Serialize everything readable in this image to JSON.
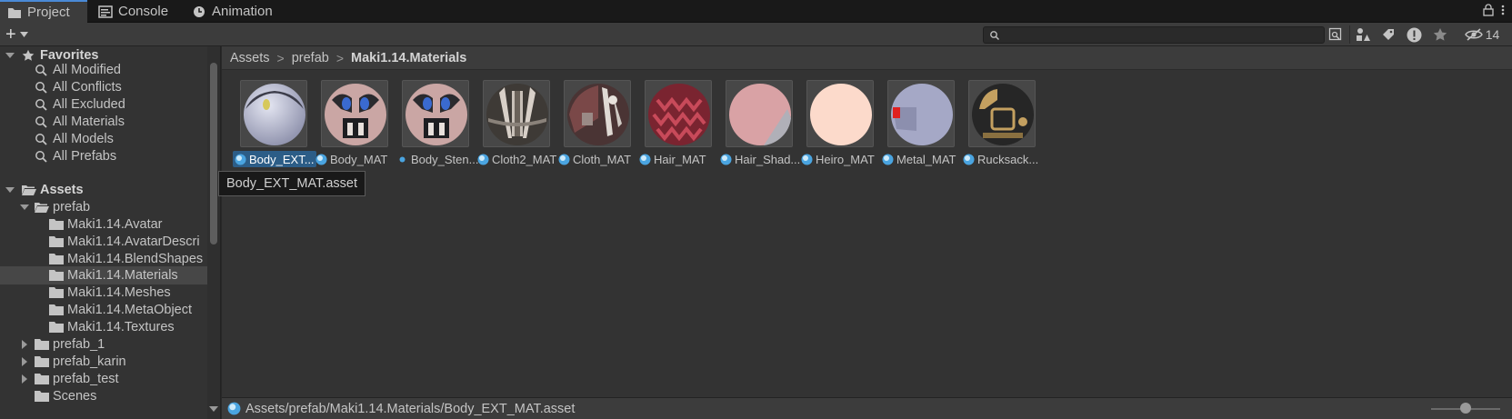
{
  "tabs": [
    {
      "label": "Project",
      "icon": "folder-icon",
      "active": true
    },
    {
      "label": "Console",
      "icon": "console-icon",
      "active": false
    },
    {
      "label": "Animation",
      "icon": "animation-clock-icon",
      "active": false
    }
  ],
  "toolbar": {
    "create_label": "+",
    "search_value": "",
    "hidden_count": "14"
  },
  "sidebar": {
    "favorites_label": "Favorites",
    "favorites": [
      "All Modified",
      "All Conflicts",
      "All Excluded",
      "All Materials",
      "All Models",
      "All Prefabs"
    ],
    "assets_label": "Assets",
    "prefab_label": "prefab",
    "prefab_children": [
      "Maki1.14.Avatar",
      "Maki1.14.AvatarDescri",
      "Maki1.14.BlendShapes",
      "Maki1.14.Materials",
      "Maki1.14.Meshes",
      "Maki1.14.MetaObject",
      "Maki1.14.Textures"
    ],
    "selected_child": "Maki1.14.Materials",
    "other_folders": [
      "prefab_1",
      "prefab_karin",
      "prefab_test",
      "Scenes"
    ]
  },
  "breadcrumb": {
    "items": [
      "Assets",
      "prefab",
      "Maki1.14.Materials"
    ],
    "separator": ">"
  },
  "assets": [
    {
      "label": "Body_EXT...",
      "selected": true,
      "color": "#c8cbe0"
    },
    {
      "label": "Body_MAT",
      "selected": false,
      "color": "#caa6a4"
    },
    {
      "label": "Body_Sten...",
      "selected": false,
      "color": "#caa6a4"
    },
    {
      "label": "Cloth2_MAT",
      "selected": false,
      "color": "#5a5048"
    },
    {
      "label": "Cloth_MAT",
      "selected": false,
      "color": "#6a4040"
    },
    {
      "label": "Hair_MAT",
      "selected": false,
      "color": "#a83a48"
    },
    {
      "label": "Hair_Shad...",
      "selected": false,
      "color": "#d9a2a5"
    },
    {
      "label": "Heiro_MAT",
      "selected": false,
      "color": "#fcdacb"
    },
    {
      "label": "Metal_MAT",
      "selected": false,
      "color": "#a5a8c6"
    },
    {
      "label": "Rucksack...",
      "selected": false,
      "color": "#2a2a2a"
    }
  ],
  "tooltip": "Body_EXT_MAT.asset",
  "status": {
    "path": "Assets/prefab/Maki1.14.Materials/Body_EXT_MAT.asset"
  },
  "colors": {
    "selection": "#2c5d87",
    "accent": "#4a8ad6",
    "material_icon": "#4aa4e0"
  }
}
